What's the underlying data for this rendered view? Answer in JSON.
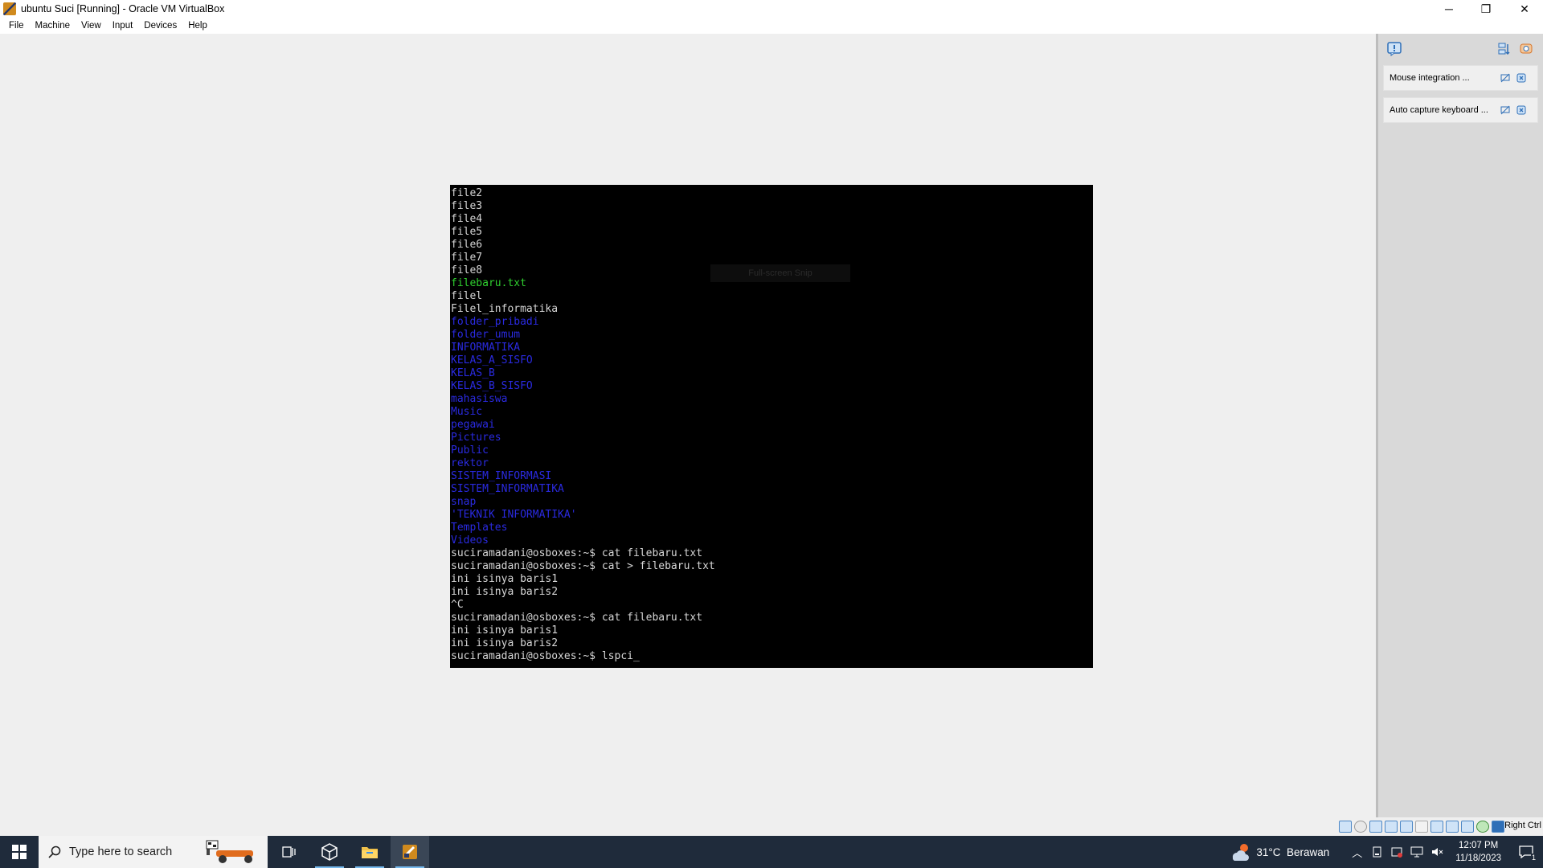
{
  "window": {
    "title": "ubuntu Suci [Running] - Oracle VM VirtualBox",
    "controls": {
      "minimize": "─",
      "restore": "❐",
      "close": "✕"
    }
  },
  "menu": [
    "File",
    "Machine",
    "View",
    "Input",
    "Devices",
    "Help"
  ],
  "terminal": {
    "lines": [
      {
        "text": "file2",
        "color": "white"
      },
      {
        "text": "file3",
        "color": "white"
      },
      {
        "text": "file4",
        "color": "white"
      },
      {
        "text": "file5",
        "color": "white"
      },
      {
        "text": "file6",
        "color": "white"
      },
      {
        "text": "file7",
        "color": "white"
      },
      {
        "text": "file8",
        "color": "white"
      },
      {
        "text": "filebaru.txt",
        "color": "green"
      },
      {
        "text": "filel",
        "color": "white"
      },
      {
        "text": "Filel_informatika",
        "color": "white"
      },
      {
        "text": "folder_pribadi",
        "color": "blue"
      },
      {
        "text": "folder_umum",
        "color": "blue"
      },
      {
        "text": "INFORMATIKA",
        "color": "blue"
      },
      {
        "text": "KELAS_A_SISFO",
        "color": "blue"
      },
      {
        "text": "KELAS_B",
        "color": "blue"
      },
      {
        "text": "KELAS_B_SISFO",
        "color": "blue"
      },
      {
        "text": "mahasiswa",
        "color": "blue"
      },
      {
        "text": "Music",
        "color": "blue"
      },
      {
        "text": "pegawai",
        "color": "blue"
      },
      {
        "text": "Pictures",
        "color": "blue"
      },
      {
        "text": "Public",
        "color": "blue"
      },
      {
        "text": "rektor",
        "color": "blue"
      },
      {
        "text": "SISTEM_INFORMASI",
        "color": "blue"
      },
      {
        "text": "SISTEM_INFORMATIKA",
        "color": "blue"
      },
      {
        "text": "snap",
        "color": "blue"
      },
      {
        "text": "'TEKNIK INFORMATIKA'",
        "color": "blue"
      },
      {
        "text": "Templates",
        "color": "blue"
      },
      {
        "text": "Videos",
        "color": "blue"
      },
      {
        "text": "suciramadani@osboxes:~$ cat filebaru.txt",
        "color": "white"
      },
      {
        "text": "suciramadani@osboxes:~$ cat > filebaru.txt",
        "color": "white"
      },
      {
        "text": "ini isinya baris1",
        "color": "white"
      },
      {
        "text": "ini isinya baris2",
        "color": "white"
      },
      {
        "text": "^C",
        "color": "white"
      },
      {
        "text": "suciramadani@osboxes:~$ cat filebaru.txt",
        "color": "white"
      },
      {
        "text": "ini isinya baris1",
        "color": "white"
      },
      {
        "text": "ini isinya baris2",
        "color": "white"
      },
      {
        "text": "suciramadani@osboxes:~$ lspci_",
        "color": "white"
      }
    ],
    "ghost_tooltip": "Full-screen Snip"
  },
  "notifications": [
    {
      "label": "Mouse integration ..."
    },
    {
      "label": "Auto capture keyboard ..."
    }
  ],
  "statusbar": {
    "host_key": "Right Ctrl"
  },
  "taskbar": {
    "search_placeholder": "Type here to search",
    "weather": "31°C  Berawan",
    "time": "12:07 PM",
    "date": "11/18/2023",
    "notification_count": "1"
  },
  "colors": {
    "terminal_bg": "#000000",
    "ls_dir": "#2a2ae0",
    "ls_exec": "#2fcf2f",
    "taskbar": "#1f2b3b"
  }
}
